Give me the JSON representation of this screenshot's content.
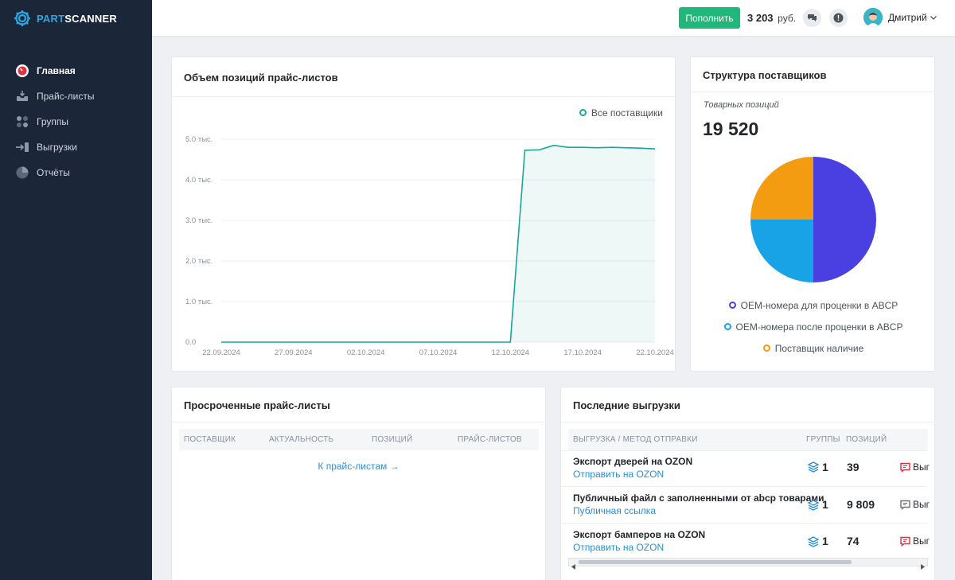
{
  "brand": {
    "part1": "PART",
    "part2": "SCANNER"
  },
  "sidebar": {
    "items": [
      {
        "label": "Главная",
        "icon": "dashboard-icon",
        "active": true
      },
      {
        "label": "Прайс-листы",
        "icon": "inbox-icon",
        "active": false
      },
      {
        "label": "Группы",
        "icon": "groups-icon",
        "active": false
      },
      {
        "label": "Выгрузки",
        "icon": "export-icon",
        "active": false
      },
      {
        "label": "Отчёты",
        "icon": "pie-chart-icon",
        "active": false
      }
    ]
  },
  "header": {
    "topup_label": "Пополнить",
    "balance_value": "3 203",
    "balance_currency": "руб.",
    "user_name": "Дмитрий"
  },
  "volume_card": {
    "title": "Объем позиций прайс-листов",
    "legend": "Все поставщики"
  },
  "suppliers_card": {
    "title": "Структура поставщиков",
    "subtitle": "Товарных позиций",
    "total": "19 520",
    "legend": [
      "OEM-номера для проценки в ABCP",
      "OEM-номера после проценки в ABCP",
      "Поставщик наличие"
    ]
  },
  "overdue_card": {
    "title": "Просроченные прайс-листы",
    "columns": [
      "Поставщик",
      "Актуальность",
      "Позиций",
      "Прайс-листов"
    ],
    "link": "К прайс-листам →"
  },
  "exports_card": {
    "title": "Последние выгрузки",
    "columns": [
      "Выгрузка / метод отправки",
      "Группы",
      "Позиций"
    ],
    "rows": [
      {
        "title": "Экспорт дверей на OZON",
        "method": "Отправить на OZON",
        "groups": "1",
        "positions": "39",
        "action": "Выг",
        "action_color": "#e0313f"
      },
      {
        "title": "Публичный файл с заполненными от abcp товарами",
        "method": "Публичная ссылка",
        "groups": "1",
        "positions": "9 809",
        "action": "Выг",
        "action_color": "#6c737c"
      },
      {
        "title": "Экспорт бамперов на OZON",
        "method": "Отправить на OZON",
        "groups": "1",
        "positions": "74",
        "action": "Выг",
        "action_color": "#e0313f"
      }
    ]
  },
  "colors": {
    "accent_green": "#1fb77a",
    "line_teal": "#17a89a",
    "pie_purple": "#4a3fe0",
    "pie_blue": "#17a3e6",
    "pie_orange": "#f39c12"
  },
  "chart_data": [
    {
      "type": "area",
      "title": "Объем позиций прайс-листов",
      "series": [
        {
          "name": "Все поставщики",
          "x": [
            "22.09.2024",
            "23.09.2024",
            "24.09.2024",
            "25.09.2024",
            "26.09.2024",
            "27.09.2024",
            "28.09.2024",
            "29.09.2024",
            "30.09.2024",
            "01.10.2024",
            "02.10.2024",
            "03.10.2024",
            "04.10.2024",
            "05.10.2024",
            "06.10.2024",
            "07.10.2024",
            "08.10.2024",
            "09.10.2024",
            "10.10.2024",
            "11.10.2024",
            "12.10.2024",
            "13.10.2024",
            "14.10.2024",
            "15.10.2024",
            "16.10.2024",
            "17.10.2024",
            "18.10.2024",
            "19.10.2024",
            "20.10.2024",
            "21.10.2024",
            "22.10.2024"
          ],
          "values": [
            0,
            0,
            0,
            0,
            0,
            0,
            0,
            0,
            0,
            0,
            0,
            0,
            0,
            0,
            0,
            0,
            0,
            0,
            0,
            0,
            0,
            4730,
            4740,
            4850,
            4800,
            4800,
            4790,
            4800,
            4790,
            4780,
            4760
          ]
        }
      ],
      "x_ticks": [
        "22.09.2024",
        "27.09.2024",
        "02.10.2024",
        "07.10.2024",
        "12.10.2024",
        "17.10.2024",
        "22.10.2024"
      ],
      "y_ticks": [
        "0.0",
        "1.0 тыс.",
        "2.0 тыс.",
        "3.0 тыс.",
        "4.0 тыс.",
        "5.0 тыс."
      ],
      "ylim": [
        0,
        5000
      ],
      "grid": true,
      "legend_position": "top-right"
    },
    {
      "type": "pie",
      "title": "Структура поставщиков",
      "labels": [
        "OEM-номера для проценки в ABCP",
        "OEM-номера после проценки в ABCP",
        "Поставщик наличие"
      ],
      "values": [
        9760,
        4880,
        4880
      ],
      "legend_position": "bottom"
    }
  ]
}
